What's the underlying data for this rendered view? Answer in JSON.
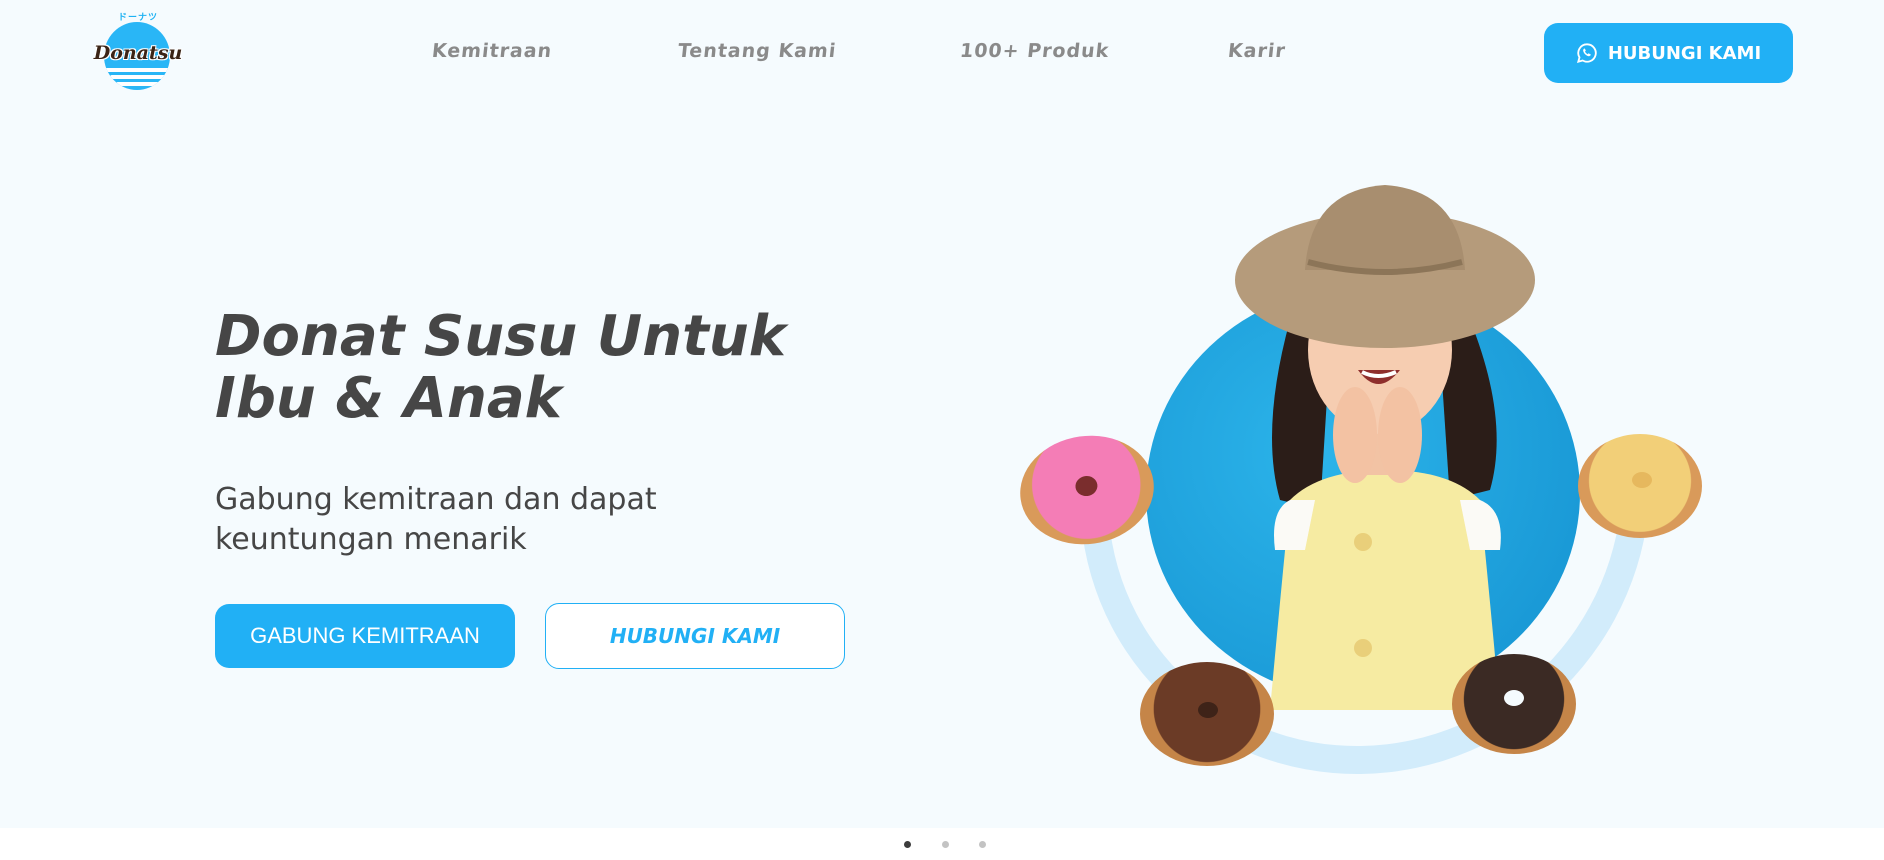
{
  "brand": {
    "logo_text": "Donatsu",
    "logo_kana": "ドーナツ",
    "accent_color": "#21b0f5"
  },
  "nav": {
    "items": [
      {
        "label": "Kemitraan"
      },
      {
        "label": "Tentang Kami"
      },
      {
        "label": "100+ Produk"
      },
      {
        "label": "Karir"
      }
    ],
    "cta_label": "HUBUNGI KAMI",
    "cta_icon": "whatsapp-icon"
  },
  "hero": {
    "title_line1": "Donat Susu Untuk",
    "title_line2": "Ibu & Anak",
    "subtitle_line1": "Gabung kemitraan dan dapat",
    "subtitle_line2": "keuntungan menarik",
    "primary_button": "GABUNG KEMITRAAN",
    "secondary_button": "HUBUNGI KAMI"
  },
  "carousel": {
    "slide_count": 3,
    "active_index": 0
  }
}
